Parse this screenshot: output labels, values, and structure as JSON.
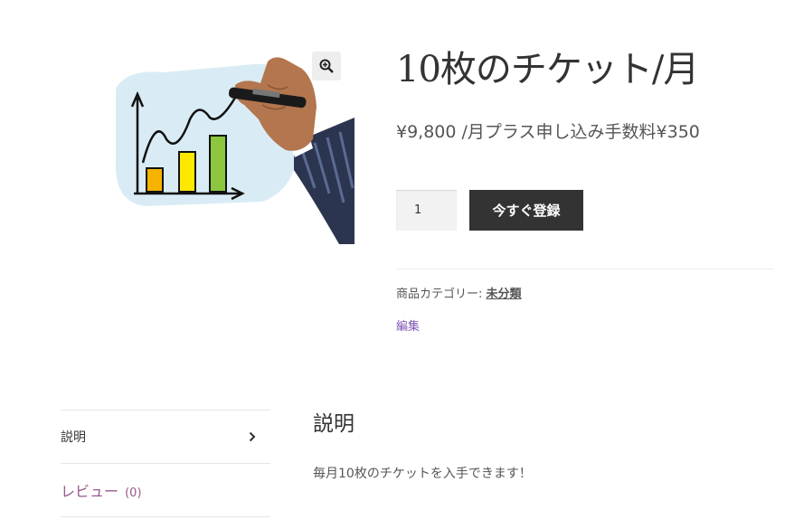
{
  "product": {
    "title": "10枚のチケット/月",
    "price": "¥9,800 /月プラス申し込み手数料¥350",
    "quantity_value": "1",
    "add_to_cart_label": "今すぐ登録",
    "category_label": "商品カテゴリー:",
    "category_value": "未分類",
    "edit_label": "編集",
    "image_icon": "chart-drawing-illustration",
    "zoom_icon": "zoom-in-icon"
  },
  "tabs": {
    "description_label": "説明",
    "reviews_label": "レビュー",
    "reviews_count": "(0)",
    "chevron_icon": "chevron-right-icon"
  },
  "panel": {
    "heading": "説明",
    "text": "毎月10枚のチケットを入手できます！"
  },
  "colors": {
    "button_bg": "#333333",
    "link_purple": "#96588a",
    "edit_link": "#7f54b3"
  }
}
